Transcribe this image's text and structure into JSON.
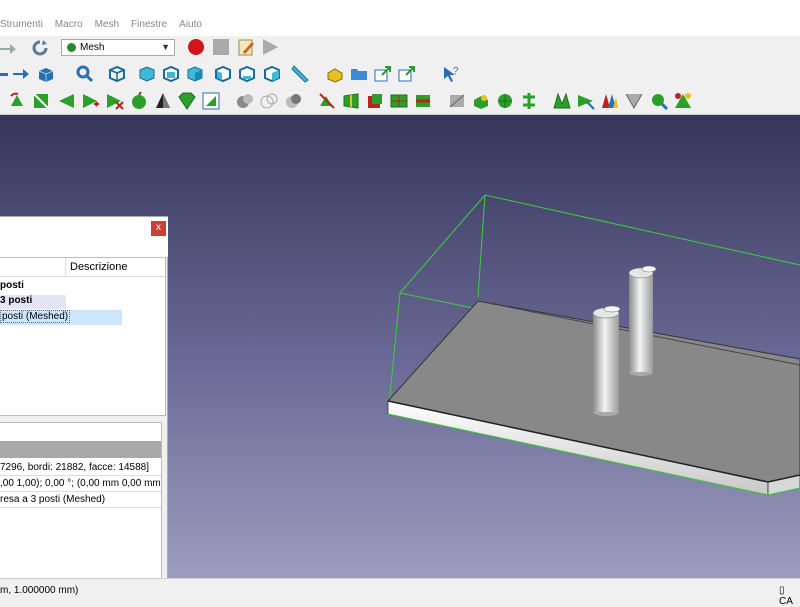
{
  "menu": {
    "items": [
      "Strumenti",
      "Macro",
      "Mesh",
      "Finestre",
      "Aiuto"
    ]
  },
  "toolbar": {
    "workbench_value": "Mesh"
  },
  "tree": {
    "col_description": "Descrizione",
    "rows": [
      "posti",
      "3 posti",
      "posti (Meshed)"
    ]
  },
  "properties": {
    "rows": [
      "7296, bordi: 21882, facce: 14588]",
      ",00 1,00); 0,00 °; (0,00 mm  0,00 mm",
      "resa a 3 posti (Meshed)"
    ]
  },
  "status": {
    "dims": "m, 1.000000 mm)",
    "nav": "CA"
  },
  "colors": {
    "viewport_top": "#36365c",
    "viewport_bottom": "#9d9dc0",
    "bbox": "#3ccf3c",
    "selection": "#cde6ff"
  }
}
